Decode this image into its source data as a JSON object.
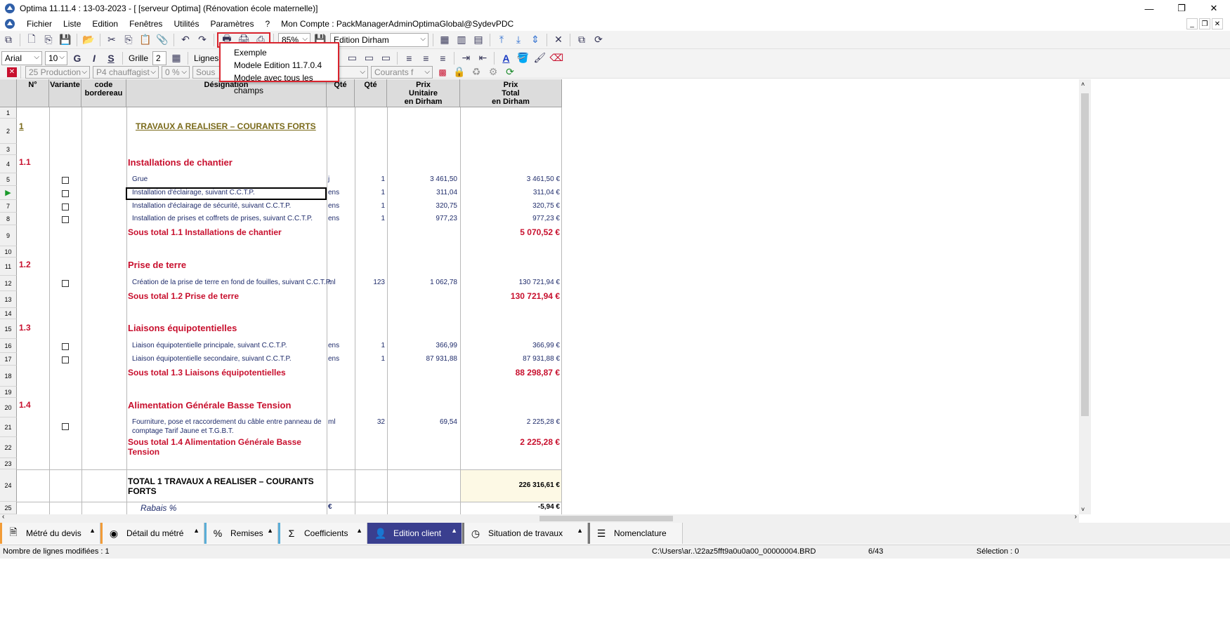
{
  "window": {
    "title": "Optima 11.11.4 : 13-03-2023 - [ [serveur Optima] (Rénovation école maternelle)]",
    "min": "—",
    "max": "❐",
    "close": "✕"
  },
  "menu": {
    "items": [
      "Fichier",
      "Liste",
      "Edition",
      "Fenêtres",
      "Utilités",
      "Paramètres",
      "?",
      "Mon Compte : PackManagerAdminOptimaGlobal@SydevPDC"
    ]
  },
  "toolbar1": {
    "zoom": "85%",
    "edition": "Edition Dirham"
  },
  "toolbar2": {
    "font": "Arial",
    "size": "10",
    "bold": "G",
    "italic": "I",
    "underline": "S",
    "grid_label": "Grille",
    "grid_value": "2",
    "lines_label": "Lignes"
  },
  "toolbar3": {
    "production": "25  Production",
    "chauffage": "P4  chauffagist",
    "percent": "0 %",
    "sous": "Sous",
    "courants": "Courants f"
  },
  "dropdown": {
    "items": [
      "Exemple",
      "Modele Edition 11.7.0.4",
      "Modele avec tous les champs"
    ]
  },
  "columns": {
    "num": "N°",
    "variante": "Variante",
    "code": "code\nbordereau",
    "designation": "Désignation",
    "qte_unit": "Qté",
    "qte": "Qté",
    "pu": "Prix\nUnitaire\nen Dirham",
    "pt": "Prix\nTotal\nen Dirham"
  },
  "rows": {
    "r2_num": "1",
    "r2_title": "TRAVAUX A REALISER – COURANTS FORTS",
    "r4_num": "1.1",
    "r4_title": "Installations de chantier",
    "r5": {
      "designation": "Grue",
      "unit": "j",
      "qte": "1",
      "pu": "3 461,50",
      "pt": "3 461,50 €"
    },
    "r6": {
      "designation": "Installation d'éclairage, suivant C.C.T.P.",
      "unit": "ens",
      "qte": "1",
      "pu": "311,04",
      "pt": "311,04 €"
    },
    "r7": {
      "designation": "Installation d'éclairage de sécurité, suivant C.C.T.P.",
      "unit": "ens",
      "qte": "1",
      "pu": "320,75",
      "pt": "320,75 €"
    },
    "r8": {
      "designation": "Installation de prises et coffrets de prises, suivant C.C.T.P.",
      "unit": "ens",
      "qte": "1",
      "pu": "977,23",
      "pt": "977,23 €"
    },
    "r9": {
      "label": "Sous total 1.1 Installations de chantier",
      "pt": "5 070,52 €"
    },
    "r11_num": "1.2",
    "r11_title": "Prise de terre",
    "r12": {
      "designation": "Création de la prise de terre en fond de fouilles, suivant C.C.T.P.",
      "unit": "ml",
      "qte": "123",
      "pu": "1 062,78",
      "pt": "130 721,94 €"
    },
    "r13": {
      "label": "Sous total 1.2 Prise de terre",
      "pt": "130 721,94 €"
    },
    "r15_num": "1.3",
    "r15_title": "Liaisons équipotentielles",
    "r16": {
      "designation": "Liaison équipotentielle principale, suivant C.C.T.P.",
      "unit": "ens",
      "qte": "1",
      "pu": "366,99",
      "pt": "366,99 €"
    },
    "r17": {
      "designation": "Liaison équipotentielle secondaire, suivant C.C.T.P.",
      "unit": "ens",
      "qte": "1",
      "pu": "87 931,88",
      "pt": "87 931,88 €"
    },
    "r18": {
      "label": "Sous total 1.3 Liaisons équipotentielles",
      "pt": "88 298,87 €"
    },
    "r20_num": "1.4",
    "r20_title": "Alimentation Générale Basse Tension",
    "r21": {
      "designation1": "Fourniture, pose et raccordement du câble entre panneau de",
      "designation2": "comptage Tarif Jaune et T.G.B.T.",
      "unit": "ml",
      "qte": "32",
      "pu": "69,54",
      "pt": "2 225,28 €"
    },
    "r22": {
      "label1": "Sous total 1.4 Alimentation Générale Basse",
      "label2": "Tension",
      "pt": "2 225,28 €"
    },
    "r24": {
      "label1": "TOTAL 1 TRAVAUX A REALISER – COURANTS",
      "label2": "FORTS",
      "pt": "226 316,61 €"
    },
    "r25": {
      "label": "Rabais %",
      "unit": "€",
      "pt": "-5,94 €"
    }
  },
  "rownums": [
    "1",
    "2",
    "3",
    "4",
    "5",
    "6",
    "7",
    "8",
    "9",
    "10",
    "11",
    "12",
    "13",
    "14",
    "15",
    "16",
    "17",
    "18",
    "19",
    "20",
    "21",
    "22",
    "23",
    "24",
    "25"
  ],
  "tabs": [
    {
      "label": "Métré du devis",
      "icon": "document-icon"
    },
    {
      "label": "Détail du métré",
      "icon": "eye-icon"
    },
    {
      "label": "Remises",
      "icon": "percent-icon"
    },
    {
      "label": "Coefficients",
      "icon": "sigma-icon"
    },
    {
      "label": "Edition client",
      "icon": "user-icon"
    },
    {
      "label": "Situation de travaux",
      "icon": "clock-icon"
    },
    {
      "label": "Nomenclature",
      "icon": "list-icon"
    }
  ],
  "status": {
    "modified": "Nombre de lignes modifiées : 1",
    "path": "C:\\Users\\ar..\\22az5fft9a0u0a00_00000004.BRD",
    "page": "6/43",
    "selection": "Sélection : 0"
  },
  "colors": {
    "accent_red": "#c8102e",
    "tab_active": "#3a3f8f",
    "highlight_red": "#d9232d"
  }
}
